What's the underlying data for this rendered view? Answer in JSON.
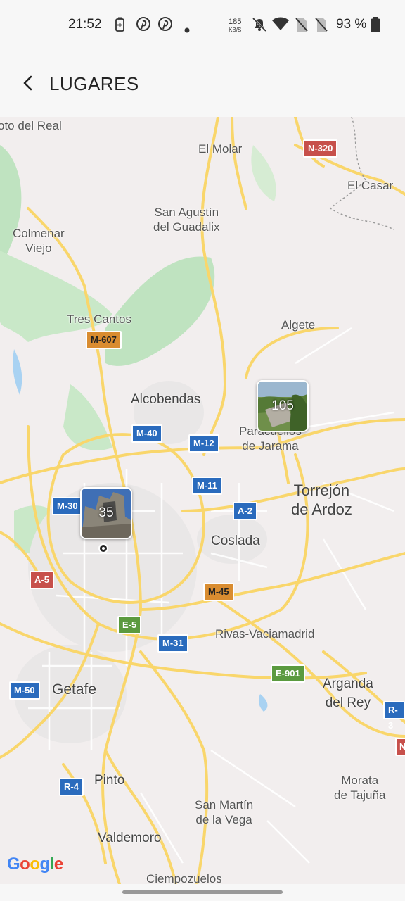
{
  "status_bar": {
    "time": "21:52",
    "net_speed_value": "185",
    "net_speed_unit": "KB/S",
    "battery": "93 %",
    "icons": [
      "battery-saver-icon",
      "pinterest-icon",
      "pinterest-icon",
      "dot-icon",
      "mute-icon",
      "wifi-icon",
      "no-sim-icon",
      "no-sim-icon",
      "battery-icon"
    ]
  },
  "app_bar": {
    "title": "LUGARES",
    "back_icon": "back-arrow-icon"
  },
  "map": {
    "places": {
      "soto_del_real": "oto del Real",
      "el_molar": "El Molar",
      "el_casar": "El Casar",
      "san_agustin": "San Agustín\ndel Guadalix",
      "colmenar_viejo": "Colmenar\nViejo",
      "tres_cantos": "Tres Cantos",
      "algete": "Algete",
      "alcobendas": "Alcobendas",
      "paracuellos": "Paracuellos\nde Jarama",
      "torrejon": "Torrejón\nde Ardoz",
      "coslada": "Coslada",
      "rivas": "Rivas-Vaciamadrid",
      "getafe": "Getafe",
      "arganda": "Arganda\ndel Rey",
      "pinto": "Pinto",
      "morata": "Morata\nde Tajuña",
      "san_martin": "San Martín\nde la Vega",
      "valdemoro": "Valdemoro",
      "ciempozuelos": "Ciempozuelos"
    },
    "roads": {
      "n320": "N-320",
      "m607": "M-607",
      "m40": "M-40",
      "m12": "M-12",
      "m11": "M-11",
      "m30": "M-30",
      "a2": "A-2",
      "a5": "A-5",
      "m45": "M-45",
      "e5": "E-5",
      "m31": "M-31",
      "e901": "E-901",
      "m50": "M-50",
      "r3": "R-3",
      "r4": "R-4",
      "n_partial": "N"
    },
    "clusters": [
      {
        "count": "105"
      },
      {
        "count": "35"
      }
    ],
    "attribution": {
      "g1": "G",
      "o1": "o",
      "o2": "o",
      "g2": "g",
      "l": "l",
      "e": "e"
    },
    "colors": {
      "land": "#f2eeee",
      "park": "#bfe3c0",
      "water": "#a9d2f2",
      "road_major": "#f9d66b",
      "road_minor": "#ffffff",
      "urban": "#e9e7e7"
    }
  }
}
